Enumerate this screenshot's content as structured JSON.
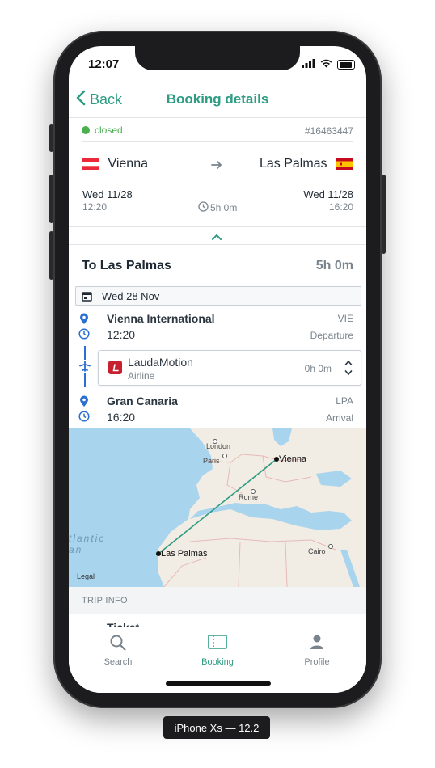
{
  "status_bar": {
    "time": "12:07"
  },
  "nav": {
    "back_label": "Back",
    "title": "Booking details"
  },
  "booking": {
    "status": "closed",
    "reference": "#16463447"
  },
  "route": {
    "origin": {
      "city": "Vienna",
      "date": "Wed 11/28",
      "time": "12:20"
    },
    "destination": {
      "city": "Las Palmas",
      "date": "Wed 11/28",
      "time": "16:20"
    },
    "duration": "5h 0m"
  },
  "leg": {
    "title": "To Las Palmas",
    "duration": "5h 0m",
    "date": "Wed 28 Nov",
    "departure": {
      "airport": "Vienna International",
      "code": "VIE",
      "time": "12:20",
      "label": "Departure"
    },
    "airline": {
      "name": "LaudaMotion",
      "subtitle": "Airline",
      "duration": "0h 0m"
    },
    "arrival": {
      "airport": "Gran Canaria",
      "code": "LPA",
      "time": "16:20",
      "label": "Arrival"
    }
  },
  "map": {
    "labels": {
      "london": "London",
      "paris": "Paris",
      "vienna": "Vienna",
      "rome": "Rome",
      "las_palmas": "Las Palmas",
      "cairo": "Cairo",
      "atlantic": "tlantic",
      "ocean": "an"
    },
    "legal": "Legal"
  },
  "trip_info": {
    "header": "TRIP INFO",
    "partial_row": "Ticket"
  },
  "tabs": [
    {
      "label": "Search",
      "icon": "search-icon"
    },
    {
      "label": "Booking",
      "icon": "ticket-icon"
    },
    {
      "label": "Profile",
      "icon": "person-icon"
    }
  ],
  "device_label": "iPhone Xs — 12.2",
  "colors": {
    "accent": "#2d9c83",
    "status_green": "#4caf50",
    "muted": "#7a848d",
    "airline_red": "#c8202f",
    "pin_blue": "#2a6fd1"
  }
}
